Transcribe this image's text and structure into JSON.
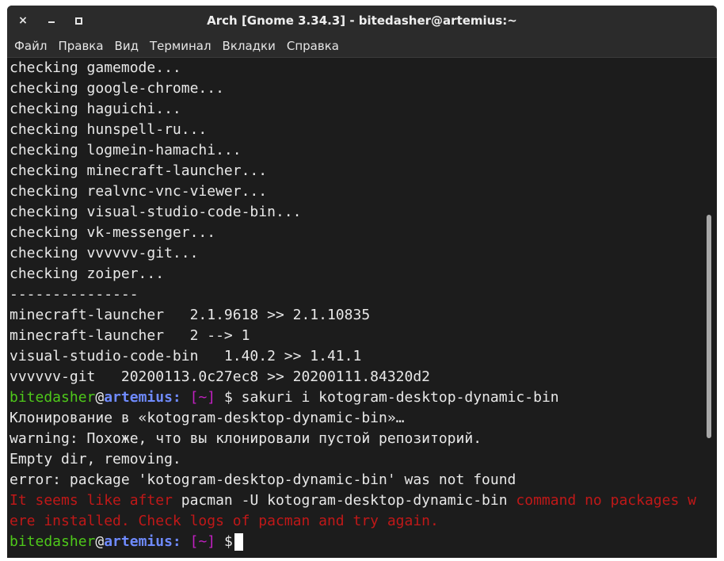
{
  "window": {
    "title": "Arch [Gnome 3.34.3] - bitedasher@artemius:~",
    "close_glyph": "×"
  },
  "menu": [
    "Файл",
    "Правка",
    "Вид",
    "Терминал",
    "Вкладки",
    "Справка"
  ],
  "terminal": {
    "lines": [
      "checking gamemode...",
      "checking google-chrome...",
      "checking haguichi...",
      "checking hunspell-ru...",
      "checking logmein-hamachi...",
      "checking minecraft-launcher...",
      "checking realvnc-vnc-viewer...",
      "checking visual-studio-code-bin...",
      "checking vk-messenger...",
      "checking vvvvvv-git...",
      "checking zoiper...",
      "---------------",
      "minecraft-launcher   2.1.9618 >> 2.1.10835",
      "minecraft-launcher   2 --> 1",
      "visual-studio-code-bin   1.40.2 >> 1.41.1",
      "vvvvvv-git   20200113.0c27ec8 >> 20200111.84320d2"
    ],
    "prompt": {
      "user": "bitedasher",
      "at": "@",
      "host": "artemius:",
      "dir": " [~]",
      "dollar": " $"
    },
    "command": " sakuri i kotogram-desktop-dynamic-bin",
    "output_lines": [
      "Клонирование в «kotogram-desktop-dynamic-bin»…",
      "warning: Похоже, что вы клонировали пустой репозиторий.",
      "Empty dir, removing.",
      "error: package 'kotogram-desktop-dynamic-bin' was not found"
    ],
    "error_msg": {
      "part1": "It seems like after ",
      "part2": "pacman -U kotogram-desktop-dynamic-bin",
      "part3": " command no packages w",
      "part4": "ere installed. Check logs of pacman and try again."
    }
  },
  "scrollbar": {
    "position_fraction": 0.55
  }
}
